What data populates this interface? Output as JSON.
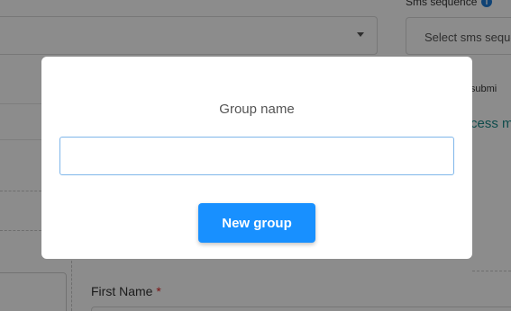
{
  "background": {
    "sms_sequence_label": "Sms sequence",
    "sms_select_placeholder": "Select sms sequence",
    "after_submit_text": "er submi",
    "success_text": "cess m",
    "first_name_label": "First Name",
    "required_mark": "*"
  },
  "modal": {
    "title": "Group name",
    "input_value": "",
    "input_placeholder": "",
    "submit_label": "New group"
  },
  "colors": {
    "primary": "#1890ff",
    "overlay": "rgba(0,0,0,0.45)",
    "required": "#e02424",
    "info_icon": "#1e7bd6"
  },
  "icons": {
    "select_caret": "chevron-down-icon",
    "info": "info-icon"
  }
}
